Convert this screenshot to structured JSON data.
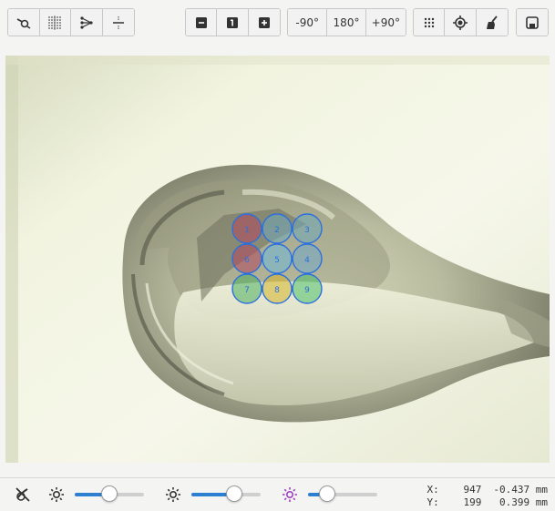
{
  "toolbar": {
    "rotate_minus_90": "-90°",
    "rotate_180": "180°",
    "rotate_plus_90": "+90°"
  },
  "grid": {
    "cells": [
      {
        "label": "1",
        "color": "#b0475e"
      },
      {
        "label": "2",
        "color": "#6fa8b8"
      },
      {
        "label": "3",
        "color": "#6fa8b8"
      },
      {
        "label": "6",
        "color": "#b0475e"
      },
      {
        "label": "5",
        "color": "#6fb8d8"
      },
      {
        "label": "4",
        "color": "#6fa8c8"
      },
      {
        "label": "7",
        "color": "#4fae5e"
      },
      {
        "label": "8",
        "color": "#d6b52a"
      },
      {
        "label": "9",
        "color": "#4fbf6a"
      }
    ],
    "outline_color": "#2a6fe0"
  },
  "sliders": [
    {
      "name": "brightness",
      "value": 0.5,
      "color": "#2d7fd1"
    },
    {
      "name": "contrast",
      "value": 0.62,
      "color": "#2d7fd1"
    },
    {
      "name": "highlight",
      "value": 0.28,
      "color": "#2d7fd1"
    }
  ],
  "coords": {
    "x_label": "X:",
    "x_pixel": "947",
    "x_mm": "-0.437 mm",
    "y_label": "Y:",
    "y_pixel": "199",
    "y_mm": "0.399 mm"
  },
  "colors": {
    "accent": "#2d7fd1",
    "highlight_icon": "#a040c0"
  }
}
